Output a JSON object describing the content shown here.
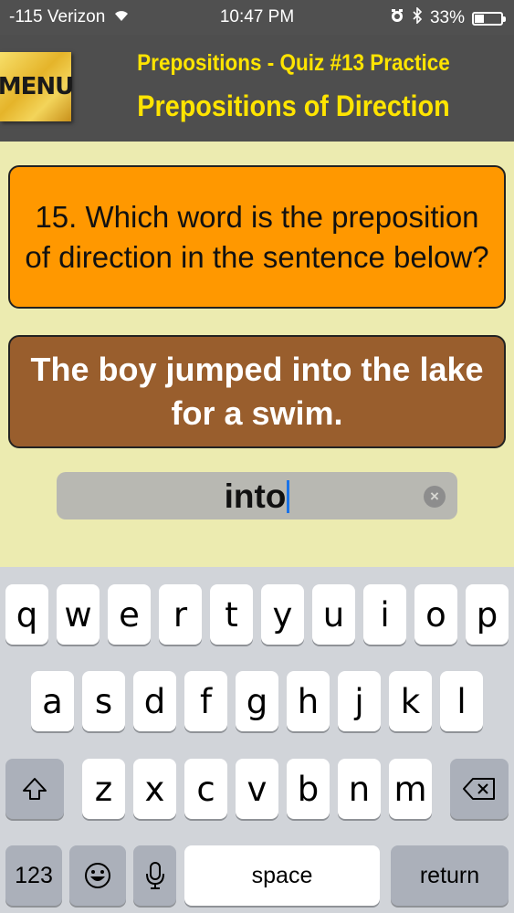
{
  "status_bar": {
    "carrier": "-115 Verizon",
    "time": "10:47 PM",
    "battery": "33%",
    "battery_level": 0.33,
    "wifi_icon": "wifi-icon",
    "alarm_icon": "alarm-icon",
    "bluetooth_icon": "bluetooth-icon"
  },
  "header": {
    "menu_label": "MENU",
    "title": "Prepositions - Quiz #13 Practice",
    "subtitle": "Prepositions of Direction"
  },
  "question": {
    "text": "15. Which word is the preposition of direction in the sentence below?"
  },
  "sentence": {
    "text": "The boy jumped into the lake for a swim."
  },
  "answer": {
    "value": "into",
    "clear_icon": "clear-circle-icon"
  },
  "keyboard": {
    "row1": [
      "q",
      "w",
      "e",
      "r",
      "t",
      "y",
      "u",
      "i",
      "o",
      "p"
    ],
    "row2": [
      "a",
      "s",
      "d",
      "f",
      "g",
      "h",
      "j",
      "k",
      "l"
    ],
    "row3": [
      "z",
      "x",
      "c",
      "v",
      "b",
      "n",
      "m"
    ],
    "numbers_label": "123",
    "space_label": "space",
    "return_label": "return",
    "shift_icon": "shift-icon",
    "delete_icon": "backspace-icon",
    "emoji_icon": "emoji-icon",
    "mic_icon": "microphone-icon"
  },
  "colors": {
    "header_bg": "#4e4e4e",
    "title_yellow": "#ffe400",
    "question_orange": "#ff9800",
    "sentence_brown": "#995e2d",
    "page_bg": "#ecebb0"
  }
}
